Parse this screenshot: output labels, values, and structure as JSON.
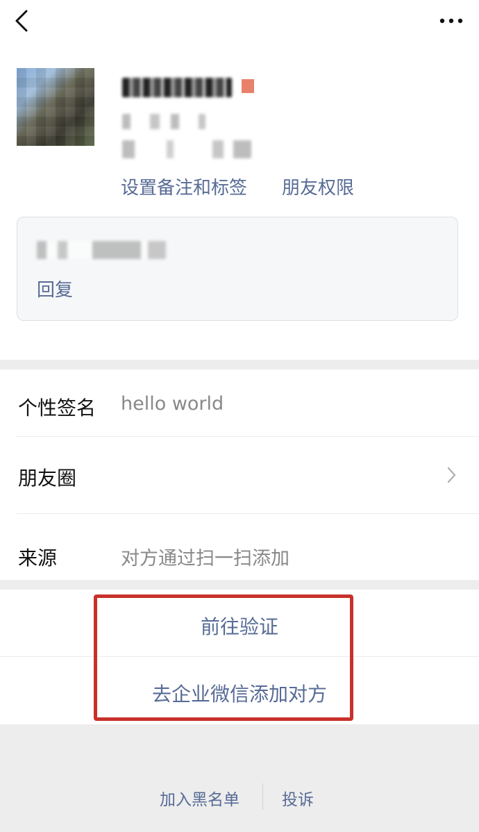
{
  "nav": {
    "back_icon": "chevron-left-icon",
    "more_icon": "more-horizontal-icon"
  },
  "profile": {
    "avatar": "blurred-landscape-photo",
    "gender_color": "#e8826a",
    "set_remark_label": "设置备注和标签",
    "friend_permission_label": "朋友权限",
    "reply_label": "回复"
  },
  "info": {
    "signature_label": "个性签名",
    "signature_value": "hello world",
    "moments_label": "朋友圈",
    "source_label": "来源",
    "source_value": "对方通过扫一扫添加"
  },
  "actions": {
    "verify_label": "前往验证",
    "wecom_label": "去企业微信添加对方",
    "highlight_color": "#c8312a"
  },
  "footer": {
    "blacklist_label": "加入黑名单",
    "report_label": "投诉"
  },
  "colors": {
    "link": "#576b95",
    "background": "#ededed"
  }
}
